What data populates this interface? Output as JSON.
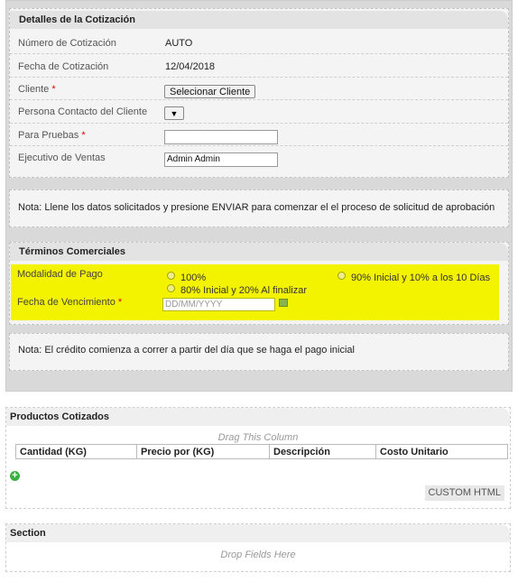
{
  "detalles": {
    "title": "Detalles de la Cotización",
    "numero": {
      "label": "Número de Cotización",
      "value": "AUTO"
    },
    "fecha": {
      "label": "Fecha de Cotización",
      "value": "12/04/2018"
    },
    "cliente": {
      "label": "Cliente",
      "required": "*",
      "button": "Selecionar Cliente"
    },
    "contacto": {
      "label": "Persona Contacto del Cliente",
      "select_glyph": "▼"
    },
    "pruebas": {
      "label": "Para Pruebas",
      "required": "*",
      "value": ""
    },
    "ejecutivo": {
      "label": "Ejecutivo de Ventas",
      "value": "Admin Admin"
    },
    "nota": "Nota: Llene los datos solicitados y presione ENVIAR para comenzar el el proceso de solicitud de aprobación"
  },
  "terminos": {
    "title": "Términos Comerciales",
    "modalidad": {
      "label": "Modalidad de Pago",
      "options": [
        "100%",
        "90% Inicial y 10% a los 10 Días",
        "80% Inicial y 20% Al finalizar"
      ]
    },
    "vencimiento": {
      "label": "Fecha de Vencimiento",
      "required": "*",
      "placeholder": "DD/MM/YYYY"
    },
    "nota": "Nota: El crédito comienza a correr a partir del día que se haga el pago inicial",
    "highlight_color": "#f3f300"
  },
  "productos": {
    "title": "Productos Cotizados",
    "drag_hint": "Drag This Column",
    "columns": [
      "Cantidad (KG)",
      "Precio por (KG)",
      "Descripción",
      "Costo Unitario"
    ],
    "custom_button": "CUSTOM HTML"
  },
  "section": {
    "title": "Section",
    "drop_hint": "Drop Fields Here"
  }
}
